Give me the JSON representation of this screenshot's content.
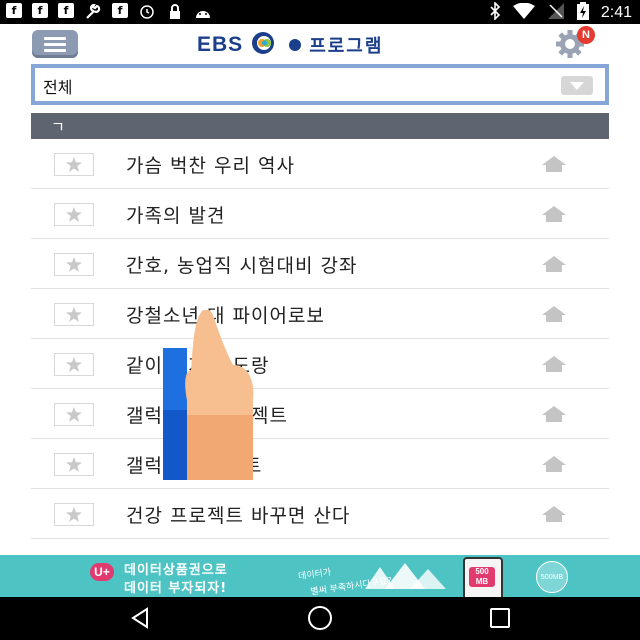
{
  "status_bar": {
    "time": "2:41",
    "left_icons": [
      "f-app-icon",
      "f-app-icon",
      "f-app-icon",
      "wrench-icon",
      "f-app-icon",
      "alarm-icon",
      "lock-icon",
      "android-icon"
    ],
    "right_icons": [
      "bluetooth-icon",
      "wifi-icon",
      "signal-icon",
      "battery-charging-icon"
    ]
  },
  "header": {
    "logo_brand": "EBS",
    "logo_text": "프로그램",
    "notification_badge": "N",
    "brand_color": "#1b3f8b"
  },
  "category_select": {
    "selected": "전체"
  },
  "section": {
    "label": "ㄱ"
  },
  "programs": [
    {
      "title": "가슴 벅찬 우리 역사"
    },
    {
      "title": "가족의 발견"
    },
    {
      "title": "간호, 농업직 시험대비 강좌"
    },
    {
      "title": "강철소년 대 파이어로보"
    },
    {
      "title": "같이 놀자 도도랑"
    },
    {
      "title": "갤럭시 빈 프로젝트"
    },
    {
      "title": "갤럭시 프로젝트"
    },
    {
      "title": "건강 프로젝트 바꾸면 산다"
    }
  ],
  "ad_banner": {
    "logo": "U+",
    "line1": "데이터상품권으로",
    "line2": "데이터 부자되자!",
    "tag1": "데이터가",
    "tag2": "별써 부족하시다구요?",
    "amount": "500 MB",
    "coin": "500MB"
  },
  "nav_bar": {
    "icons": [
      "back-icon",
      "home-icon",
      "recents-icon"
    ]
  }
}
